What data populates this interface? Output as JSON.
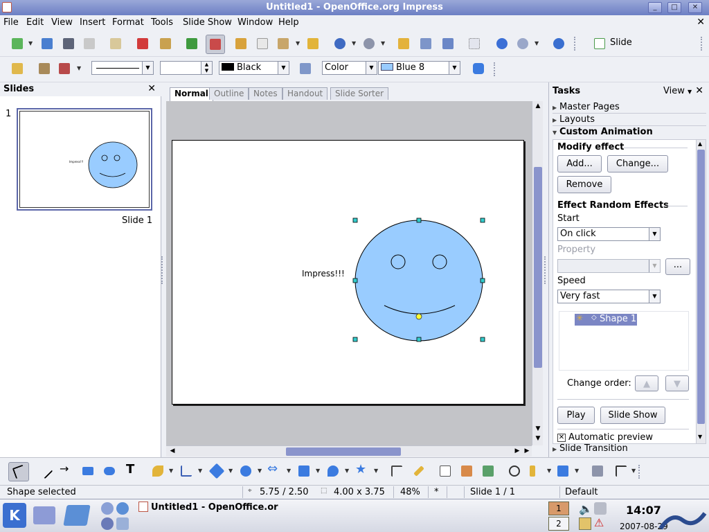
{
  "window": {
    "title": "Untitled1 - OpenOffice.org Impress"
  },
  "menu": [
    "File",
    "Edit",
    "View",
    "Insert",
    "Format",
    "Tools",
    "Slide Show",
    "Window",
    "Help"
  ],
  "standard_toolbar": {
    "slide_label": "Slide"
  },
  "line_toolbar": {
    "line_color": "Black",
    "area_style": "Color",
    "area_color": "Blue 8"
  },
  "slides_pane": {
    "title": "Slides",
    "slide_number": "1",
    "slide_caption": "Slide 1"
  },
  "view_tabs": [
    "Normal",
    "Outline",
    "Notes",
    "Handout",
    "Slide Sorter"
  ],
  "slide": {
    "text": "Impress!!!",
    "thumb_text": "Impress!!!"
  },
  "tasks": {
    "title": "Tasks",
    "view_label": "View",
    "sections": [
      "Master Pages",
      "Layouts",
      "Custom Animation"
    ],
    "modify_effect": "Modify effect",
    "add_button": "Add...",
    "change_button": "Change...",
    "remove_button": "Remove",
    "effect_title": "Effect Random Effects",
    "start_label": "Start",
    "start_value": "On click",
    "property_label": "Property",
    "property_button": "...",
    "speed_label": "Speed",
    "speed_value": "Very fast",
    "effect_item": "Shape 1",
    "change_order_label": "Change order:",
    "play_button": "Play",
    "slideshow_button": "Slide Show",
    "auto_preview": "Automatic preview",
    "slide_transition": "Slide Transition"
  },
  "status": {
    "message": "Shape selected",
    "position": "5.75 / 2.50",
    "size": "4.00 x 3.75",
    "zoom": "48%",
    "modified": "*",
    "slide": "Slide 1 / 1",
    "layout": "Default"
  },
  "taskbar": {
    "task_title": "Untitled1 - OpenOffice.or",
    "desktop": "1",
    "desktop2": "2",
    "clock": "14:07",
    "date": "2007-08-29"
  },
  "colors": {
    "accent": "#7b86c4",
    "shape_fill": "#99ccff",
    "title_bar": "#7f8ecb"
  }
}
